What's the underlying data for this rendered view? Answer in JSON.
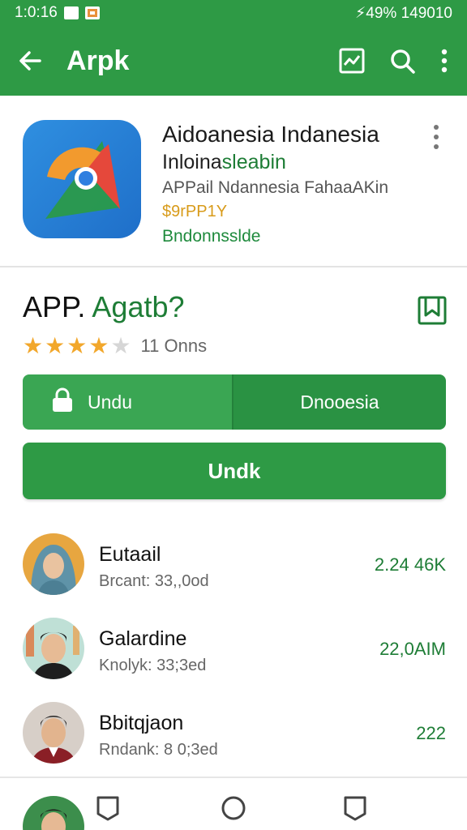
{
  "status_bar": {
    "time": "1:0:16",
    "right_text": "⚡49% 149010"
  },
  "app_bar": {
    "title": "Arpk"
  },
  "app": {
    "name": "Aidoanesia Indanesia",
    "subtitle_dark": "Inloina",
    "subtitle_green": "sleabin",
    "description": "APPail Ndannesia FahaaAKin",
    "price": "$9rPP1Y",
    "developer": "Bndonnsslde"
  },
  "section": {
    "title_dark": "APP.",
    "title_green": "Agatb?",
    "rating_value": 4,
    "rating_max": 5,
    "rating_count": "11 Onns"
  },
  "buttons": {
    "left_label": "Undu",
    "right_label": "Dnooesia",
    "primary_label": "Undk"
  },
  "list": [
    {
      "name": "Eutaail",
      "meta": "Brcant: 33,,0od",
      "value": "2.24 46K"
    },
    {
      "name": "Galardine",
      "meta": "Knolyk: 33;3ed",
      "value": "22,0AIM"
    },
    {
      "name": "Bbitqjaon",
      "meta": "Rndank: 8 0;3ed",
      "value": "222"
    }
  ],
  "colors": {
    "primary": "#2e9a45",
    "accent_text": "#1e7d36",
    "star": "#f2a72b",
    "price": "#d89b1a"
  },
  "icons": [
    "back-arrow-icon",
    "chart-icon",
    "search-icon",
    "more-vert-icon",
    "bookmark-icon",
    "lock-icon",
    "back-nav-icon",
    "home-nav-icon",
    "recents-nav-icon"
  ]
}
